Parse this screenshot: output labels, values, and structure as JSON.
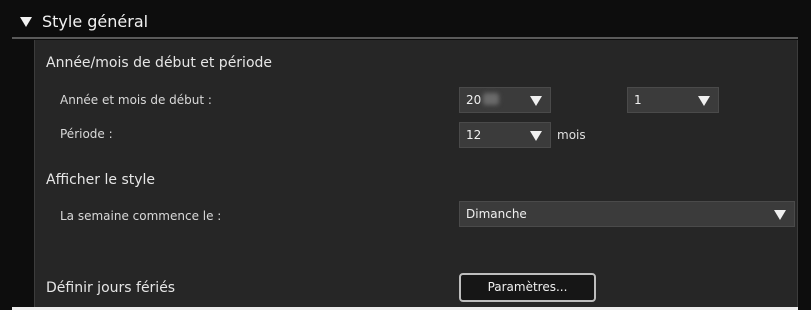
{
  "section": {
    "title": "Style général",
    "toggle_icon": "triangle-down-icon"
  },
  "start_period": {
    "title": "Année/mois de début et période",
    "start_label": "Année et mois de début :",
    "year_value": "20",
    "month_value": "1",
    "period_label": "Période :",
    "period_value": "12",
    "period_unit": "mois"
  },
  "display_style": {
    "title": "Afficher le style",
    "week_start_label": "La semaine commence le :",
    "week_start_value": "Dimanche"
  },
  "holidays": {
    "title": "Définir jours fériés",
    "button_label": "Paramètres..."
  },
  "colors": {
    "background": "#0d0d0d",
    "panel": "#262626",
    "select": "#3b3b3b",
    "text": "#e6e6e6",
    "button_border": "#bdbdbd"
  }
}
